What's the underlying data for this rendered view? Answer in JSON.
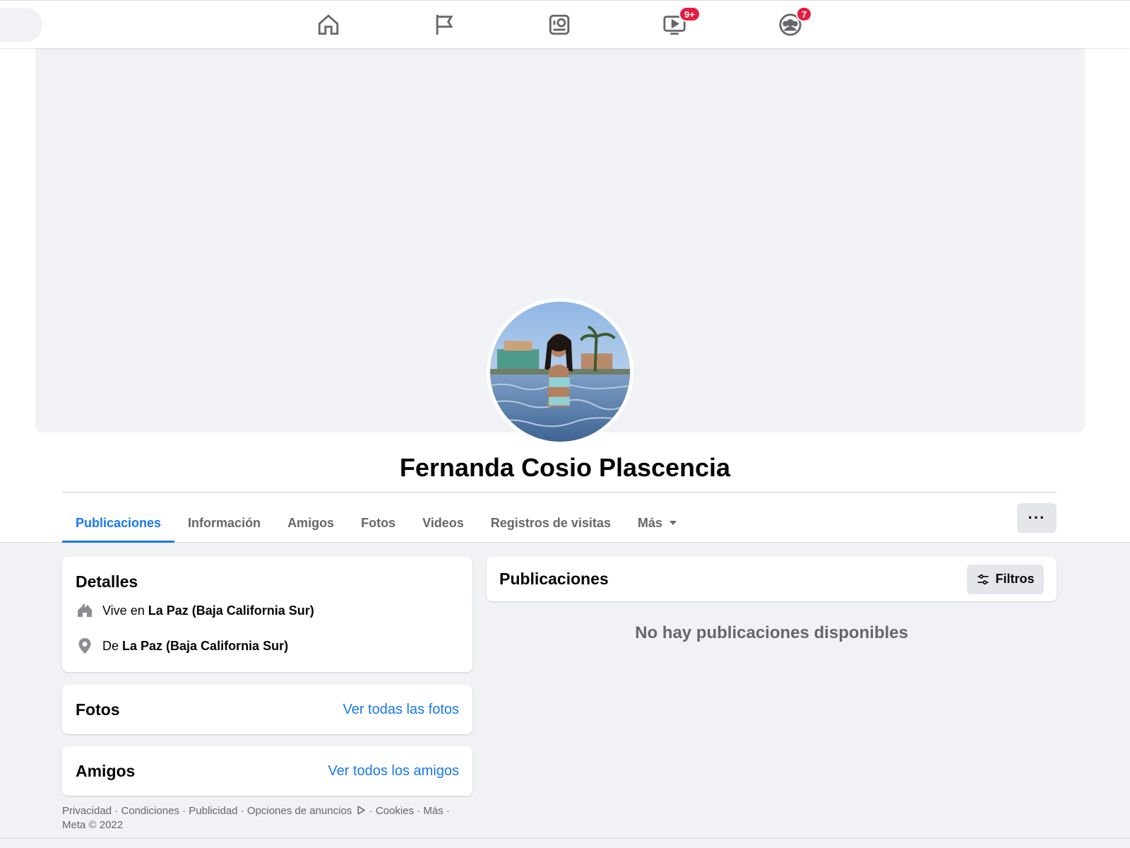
{
  "nav": {
    "icons": [
      "home-icon",
      "pages-flag-icon",
      "marketplace-icon",
      "watch-icon",
      "groups-icon"
    ],
    "watch_badge": "9+",
    "groups_badge": "7",
    "badge_color": "#e41e3f"
  },
  "profile": {
    "name": "Fernanda Cosio Plascencia"
  },
  "tabs": {
    "publicaciones": "Publicaciones",
    "informacion": "Información",
    "amigos": "Amigos",
    "fotos": "Fotos",
    "videos": "Videos",
    "registros": "Registros de visitas",
    "mas": "Más",
    "more_options": "···"
  },
  "details": {
    "title": "Detalles",
    "lives_prefix": "Vive en",
    "lives_place": "La Paz (Baja California Sur)",
    "from_prefix": "De",
    "from_place": "La Paz (Baja California Sur)"
  },
  "photos": {
    "title": "Fotos",
    "link": "Ver todas las fotos"
  },
  "friends": {
    "title": "Amigos",
    "link": "Ver todos los amigos"
  },
  "posts": {
    "title": "Publicaciones",
    "filter_label": "Filtros",
    "empty": "No hay publicaciones disponibles"
  },
  "footer": {
    "privacy": "Privacidad",
    "terms": "Condiciones",
    "advertising": "Publicidad",
    "ad_choices": "Opciones de anuncios",
    "cookies": "Cookies",
    "more": "Más",
    "sep": " · ",
    "copyright": "Meta © 2022"
  },
  "colors": {
    "accent": "#1877f2",
    "background": "#f0f2f5",
    "secondary_text": "#65676b"
  }
}
